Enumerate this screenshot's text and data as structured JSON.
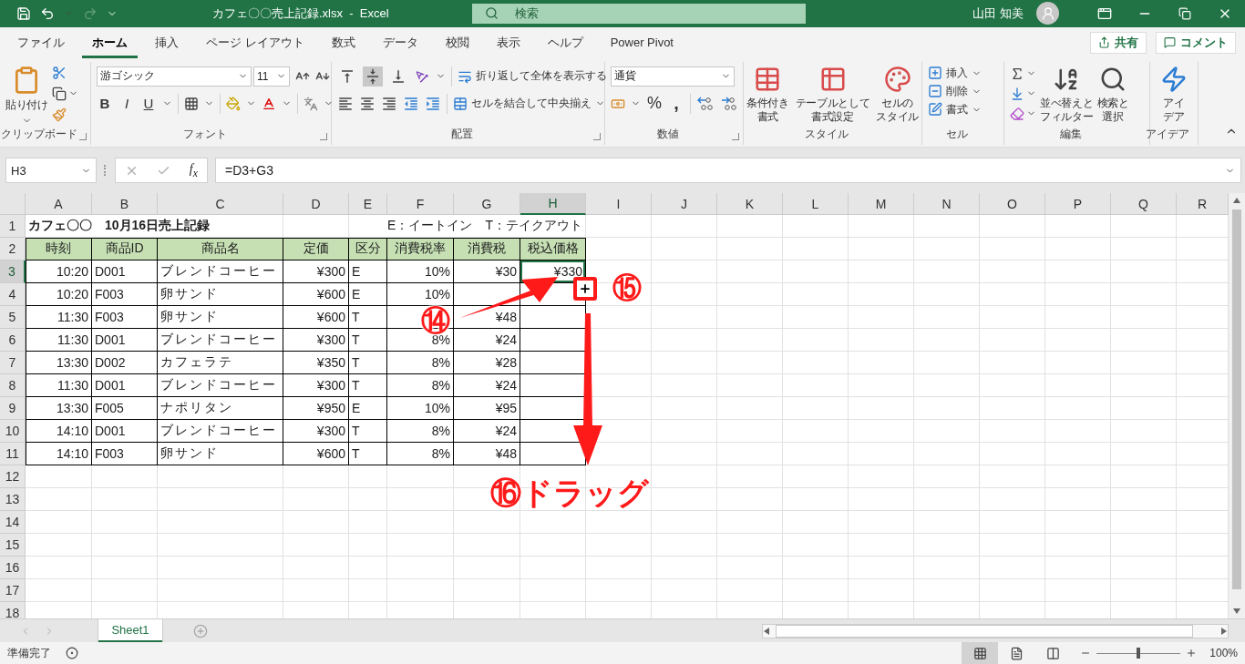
{
  "title_bar": {
    "file_title": "カフェ〇〇売上記録.xlsx  -  Excel",
    "search_placeholder": "検索",
    "user": "山田 知美",
    "redo_disabled": true
  },
  "menu_tabs": [
    {
      "label": "ファイル",
      "selected": false
    },
    {
      "label": "ホーム",
      "selected": true
    },
    {
      "label": "挿入",
      "selected": false
    },
    {
      "label": "ページ レイアウト",
      "selected": false
    },
    {
      "label": "数式",
      "selected": false
    },
    {
      "label": "データ",
      "selected": false
    },
    {
      "label": "校閲",
      "selected": false
    },
    {
      "label": "表示",
      "selected": false
    },
    {
      "label": "ヘルプ",
      "selected": false
    },
    {
      "label": "Power Pivot",
      "selected": false
    }
  ],
  "share_button": "共有",
  "comment_button": "コメント",
  "ribbon": {
    "clipboard": {
      "label": "クリップボード",
      "paste": "貼り付け"
    },
    "font": {
      "label": "フォント",
      "font_name": "游ゴシック",
      "font_size": "11",
      "bold": "B",
      "italic": "I",
      "underline": "U"
    },
    "alignment": {
      "label": "配置",
      "vertical_align": [
        {
          "selected": false
        },
        {
          "selected": true
        },
        {
          "selected": false
        }
      ],
      "wrap": "折り返して全体を表示する",
      "merge": "セルを結合して中央揃え"
    },
    "number": {
      "label": "数値",
      "format": "通貨",
      "percent": "%",
      "comma": ","
    },
    "styles": {
      "label": "スタイル",
      "buttons": [
        {
          "lines": [
            "条件付き",
            "書式"
          ]
        },
        {
          "lines": [
            "テーブルとして",
            "書式設定"
          ]
        },
        {
          "lines": [
            "セルの",
            "スタイル"
          ]
        }
      ]
    },
    "cells": {
      "label": "セル",
      "buttons": [
        "挿入",
        "削除",
        "書式"
      ]
    },
    "editing": {
      "label": "編集",
      "sort": [
        "並べ替えと",
        "フィルター"
      ],
      "find": [
        "検索と",
        "選択"
      ]
    },
    "ideas": {
      "label": "アイデア",
      "button": [
        "アイ",
        "デア"
      ]
    }
  },
  "formula_bar": {
    "name_box": "H3",
    "fx": "f$_{x}$",
    "formula": "=D3+G3"
  },
  "sheet": {
    "columns": [
      {
        "label": "A",
        "selected": false
      },
      {
        "label": "B",
        "selected": false
      },
      {
        "label": "C",
        "selected": false
      },
      {
        "label": "D",
        "selected": false
      },
      {
        "label": "E",
        "selected": false
      },
      {
        "label": "F",
        "selected": false
      },
      {
        "label": "G",
        "selected": false
      },
      {
        "label": "H",
        "selected": true
      },
      {
        "label": "I",
        "selected": false
      },
      {
        "label": "J",
        "selected": false
      },
      {
        "label": "K",
        "selected": false
      },
      {
        "label": "L",
        "selected": false
      },
      {
        "label": "M",
        "selected": false
      },
      {
        "label": "N",
        "selected": false
      },
      {
        "label": "O",
        "selected": false
      },
      {
        "label": "P",
        "selected": false
      },
      {
        "label": "Q",
        "selected": false
      },
      {
        "label": "R",
        "selected": false
      }
    ],
    "rows": [
      {
        "label": "1",
        "selected": false
      },
      {
        "label": "2",
        "selected": false
      },
      {
        "label": "3",
        "selected": true
      },
      {
        "label": "4",
        "selected": false
      },
      {
        "label": "5",
        "selected": false
      },
      {
        "label": "6",
        "selected": false
      },
      {
        "label": "7",
        "selected": false
      },
      {
        "label": "8",
        "selected": false
      },
      {
        "label": "9",
        "selected": false
      },
      {
        "label": "10",
        "selected": false
      },
      {
        "label": "11",
        "selected": false
      },
      {
        "label": "12",
        "selected": false
      },
      {
        "label": "13",
        "selected": false
      },
      {
        "label": "14",
        "selected": false
      },
      {
        "label": "15",
        "selected": false
      },
      {
        "label": "16",
        "selected": false
      },
      {
        "label": "17",
        "selected": false
      },
      {
        "label": "18",
        "selected": false
      }
    ],
    "title": "カフェ〇〇　10月16日売上記録",
    "legend": "E：イートイン　T：テイクアウト",
    "headers": [
      "時刻",
      "商品ID",
      "商品名",
      "定価",
      "区分",
      "消費税率",
      "消費税",
      "税込価格"
    ],
    "records": [
      {
        "time": "10:20",
        "id": "D001",
        "name": "ブレンドコーヒー",
        "price": "¥300",
        "type": "E",
        "rate": "10%",
        "tax": "¥30",
        "total": "¥330"
      },
      {
        "time": "10:20",
        "id": "F003",
        "name": "卵サンド",
        "price": "¥600",
        "type": "E",
        "rate": "10%"
      },
      {
        "time": "11:30",
        "id": "F003",
        "name": "卵サンド",
        "price": "¥600",
        "type": "T",
        "tax": "¥48"
      },
      {
        "time": "11:30",
        "id": "D001",
        "name": "ブレンドコーヒー",
        "price": "¥300",
        "type": "T",
        "rate": "8%",
        "tax": "¥24"
      },
      {
        "time": "13:30",
        "id": "D002",
        "name": "カフェラテ",
        "price": "¥350",
        "type": "T",
        "rate": "8%",
        "tax": "¥28"
      },
      {
        "time": "11:30",
        "id": "D001",
        "name": "ブレンドコーヒー",
        "price": "¥300",
        "type": "T",
        "rate": "8%",
        "tax": "¥24"
      },
      {
        "time": "13:30",
        "id": "F005",
        "name": "ナポリタン",
        "price": "¥950",
        "type": "E",
        "rate": "10%",
        "tax": "¥95"
      },
      {
        "time": "14:10",
        "id": "D001",
        "name": "ブレンドコーヒー",
        "price": "¥300",
        "type": "T",
        "rate": "8%",
        "tax": "¥24"
      },
      {
        "time": "14:10",
        "id": "F003",
        "name": "卵サンド",
        "price": "¥600",
        "type": "T",
        "rate": "8%",
        "tax": "¥48"
      }
    ]
  },
  "annotations": [
    {
      "text": "⑭"
    },
    {
      "text": "⑮"
    },
    {
      "text": "⑯ドラッグ"
    }
  ],
  "sheet_tabs": [
    {
      "label": "Sheet1",
      "selected": true
    }
  ],
  "status_bar": {
    "ready": "準備完了",
    "views": [
      {
        "selected": true
      },
      {
        "selected": false
      },
      {
        "selected": false
      }
    ],
    "zoom": {
      "level": 0.5,
      "reading": "100%"
    }
  }
}
